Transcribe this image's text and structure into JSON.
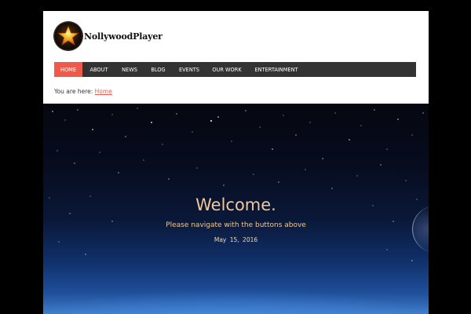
{
  "site": {
    "name": "NollywoodPlayer",
    "logo_icon": "star-logo-icon"
  },
  "nav": {
    "items": [
      {
        "label": "Home",
        "active": true
      },
      {
        "label": "About",
        "active": false
      },
      {
        "label": "News",
        "active": false
      },
      {
        "label": "Blog",
        "active": false
      },
      {
        "label": "Events",
        "active": false
      },
      {
        "label": "Our Work",
        "active": false
      },
      {
        "label": "Entertainment",
        "active": false
      }
    ]
  },
  "breadcrumb": {
    "prefix": "You are here:",
    "link": "Home"
  },
  "hero": {
    "title": "Welcome.",
    "subtitle": "Please navigate with the buttons above",
    "date": "May  15, 2016"
  },
  "colors": {
    "accent": "#f15a4a",
    "nav_bg": "#333333",
    "hero_text": "#f0c89a"
  }
}
